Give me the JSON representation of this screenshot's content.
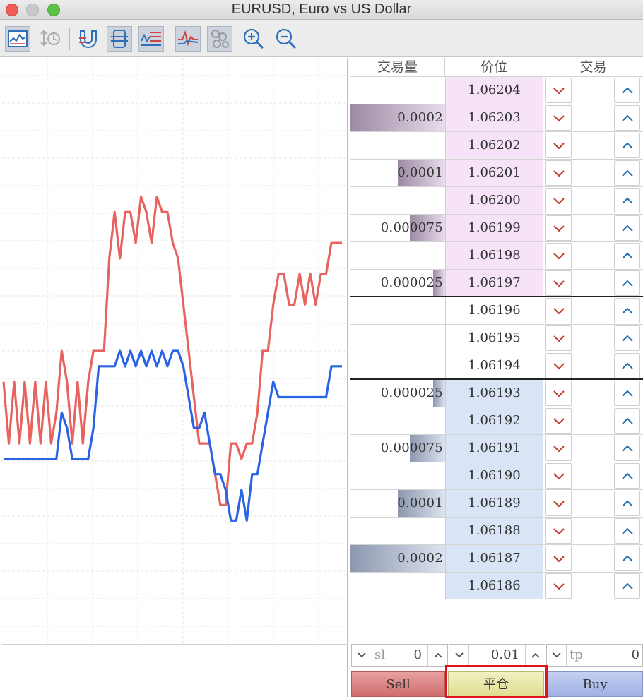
{
  "window": {
    "title": "EURUSD, Euro vs US Dollar"
  },
  "toolbar": {
    "buttons": [
      {
        "name": "chart-icon",
        "active": true
      },
      {
        "name": "history-icon",
        "active": false
      },
      {
        "name": "magnet-icon",
        "active": false
      },
      {
        "name": "depth-icon",
        "active": true
      },
      {
        "name": "list-icon",
        "active": true
      },
      {
        "name": "tick-chart-icon",
        "active": true
      },
      {
        "name": "bubbles-icon",
        "active": true
      },
      {
        "name": "zoom-in-icon",
        "active": false
      },
      {
        "name": "zoom-out-icon",
        "active": false
      }
    ]
  },
  "chart_data": {
    "type": "line",
    "series": [
      {
        "color": "#e8625f",
        "values": [
          0.57,
          0.53,
          0.57,
          0.53,
          0.57,
          0.53,
          0.57,
          0.53,
          0.57,
          0.53,
          0.55,
          0.59,
          0.57,
          0.53,
          0.57,
          0.53,
          0.57,
          0.59,
          0.59,
          0.59,
          0.65,
          0.68,
          0.65,
          0.68,
          0.68,
          0.66,
          0.69,
          0.68,
          0.66,
          0.69,
          0.68,
          0.68,
          0.66,
          0.65,
          0.62,
          0.59,
          0.56,
          0.53,
          0.53,
          0.53,
          0.51,
          0.49,
          0.49,
          0.53,
          0.53,
          0.52,
          0.53,
          0.53,
          0.55,
          0.59,
          0.59,
          0.62,
          0.64,
          0.64,
          0.62,
          0.62,
          0.64,
          0.62,
          0.64,
          0.62,
          0.64,
          0.64,
          0.66,
          0.66,
          0.66
        ]
      },
      {
        "color": "#2b63e6",
        "values": [
          0.52,
          0.52,
          0.52,
          0.52,
          0.52,
          0.52,
          0.52,
          0.52,
          0.52,
          0.52,
          0.52,
          0.55,
          0.54,
          0.52,
          0.52,
          0.52,
          0.52,
          0.54,
          0.58,
          0.58,
          0.58,
          0.58,
          0.59,
          0.58,
          0.59,
          0.58,
          0.59,
          0.58,
          0.59,
          0.58,
          0.59,
          0.58,
          0.59,
          0.59,
          0.58,
          0.56,
          0.54,
          0.54,
          0.55,
          0.53,
          0.51,
          0.51,
          0.5,
          0.48,
          0.48,
          0.5,
          0.48,
          0.51,
          0.51,
          0.53,
          0.55,
          0.57,
          0.56,
          0.56,
          0.56,
          0.56,
          0.56,
          0.56,
          0.56,
          0.56,
          0.56,
          0.56,
          0.58,
          0.58,
          0.58
        ]
      }
    ]
  },
  "dom": {
    "headers": {
      "volume": "交易量",
      "price": "价位",
      "trade": "交易"
    },
    "ask_color": "#f7e3f7",
    "bid_color": "#d9e5f7",
    "rows": [
      {
        "price": "1.06204",
        "volume": "",
        "side": "ask",
        "fill": 0
      },
      {
        "price": "1.06203",
        "volume": "0.0002",
        "side": "ask",
        "fill": 1.0
      },
      {
        "price": "1.06202",
        "volume": "",
        "side": "ask",
        "fill": 0
      },
      {
        "price": "1.06201",
        "volume": "0.0001",
        "side": "ask",
        "fill": 0.5
      },
      {
        "price": "1.06200",
        "volume": "",
        "side": "ask",
        "fill": 0
      },
      {
        "price": "1.06199",
        "volume": "0.000075",
        "side": "ask",
        "fill": 0.375
      },
      {
        "price": "1.06198",
        "volume": "",
        "side": "ask",
        "fill": 0
      },
      {
        "price": "1.06197",
        "volume": "0.000025",
        "side": "ask",
        "fill": 0.125
      },
      {
        "price": "1.06196",
        "volume": "",
        "side": "mid",
        "fill": 0
      },
      {
        "price": "1.06195",
        "volume": "",
        "side": "mid",
        "fill": 0
      },
      {
        "price": "1.06194",
        "volume": "",
        "side": "mid",
        "fill": 0
      },
      {
        "price": "1.06193",
        "volume": "0.000025",
        "side": "bid",
        "fill": 0.125
      },
      {
        "price": "1.06192",
        "volume": "",
        "side": "bid",
        "fill": 0
      },
      {
        "price": "1.06191",
        "volume": "0.000075",
        "side": "bid",
        "fill": 0.375
      },
      {
        "price": "1.06190",
        "volume": "",
        "side": "bid",
        "fill": 0
      },
      {
        "price": "1.06189",
        "volume": "0.0001",
        "side": "bid",
        "fill": 0.5
      },
      {
        "price": "1.06188",
        "volume": "",
        "side": "bid",
        "fill": 0
      },
      {
        "price": "1.06187",
        "volume": "0.0002",
        "side": "bid",
        "fill": 1.0
      },
      {
        "price": "1.06186",
        "volume": "",
        "side": "bid",
        "fill": 0
      }
    ]
  },
  "order": {
    "sl_placeholder": "sl",
    "sl_value": "0",
    "lot_value": "0.01",
    "tp_placeholder": "tp",
    "tp_value": "0",
    "sell_label": "Sell",
    "close_label": "平仓",
    "buy_label": "Buy"
  }
}
